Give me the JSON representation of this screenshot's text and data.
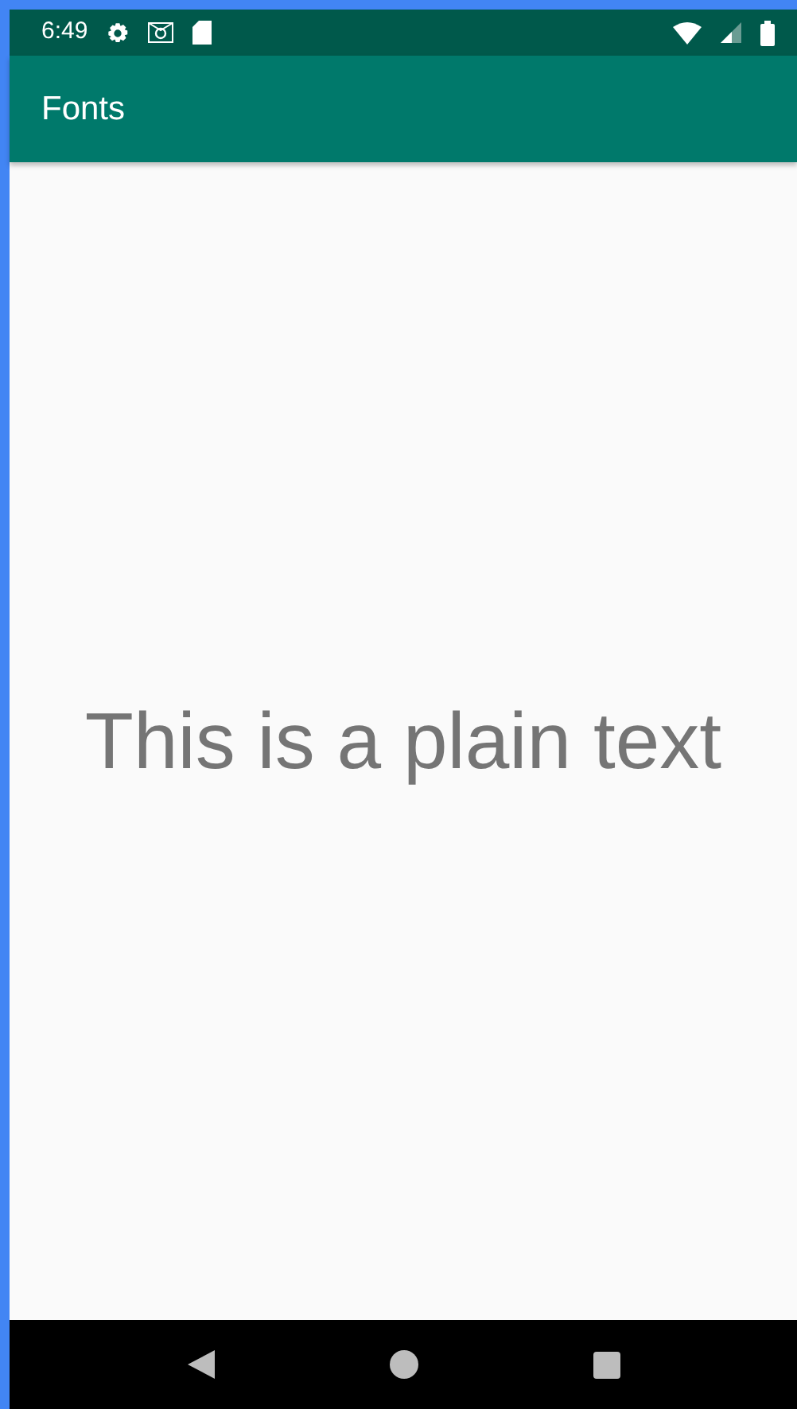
{
  "status_bar": {
    "time": "6:49"
  },
  "app_bar": {
    "title": "Fonts"
  },
  "content": {
    "text": "This is a plain text"
  }
}
